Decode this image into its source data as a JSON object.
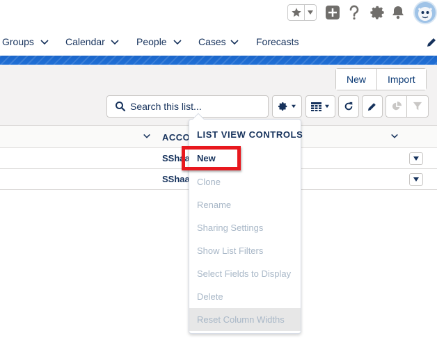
{
  "nav": {
    "items": [
      {
        "label": "Groups"
      },
      {
        "label": "Calendar"
      },
      {
        "label": "People"
      },
      {
        "label": "Cases"
      },
      {
        "label": "Forecasts"
      }
    ]
  },
  "header": {
    "new_label": "New",
    "import_label": "Import"
  },
  "search": {
    "placeholder": "Search this list..."
  },
  "table": {
    "column_header": "ACCO",
    "rows": [
      {
        "text": "SShaa"
      },
      {
        "text": "SShaa"
      }
    ]
  },
  "dropdown": {
    "title": "LIST VIEW CONTROLS",
    "items": [
      {
        "label": "New",
        "enabled": true
      },
      {
        "label": "Clone",
        "enabled": false
      },
      {
        "label": "Rename",
        "enabled": false
      },
      {
        "label": "Sharing Settings",
        "enabled": false
      },
      {
        "label": "Show List Filters",
        "enabled": false
      },
      {
        "label": "Select Fields to Display",
        "enabled": false
      },
      {
        "label": "Delete",
        "enabled": false
      },
      {
        "label": "Reset Column Widths",
        "enabled": false
      }
    ]
  },
  "colors": {
    "accent_blue": "#1b66c9",
    "highlight_red": "#e8181e",
    "text_dark": "#16325c",
    "icon_gray": "#706e6b"
  },
  "icons": {
    "favorite": "star-icon",
    "add": "plus-icon",
    "help": "question-icon",
    "setup": "gear-icon",
    "notifications": "bell-icon"
  }
}
